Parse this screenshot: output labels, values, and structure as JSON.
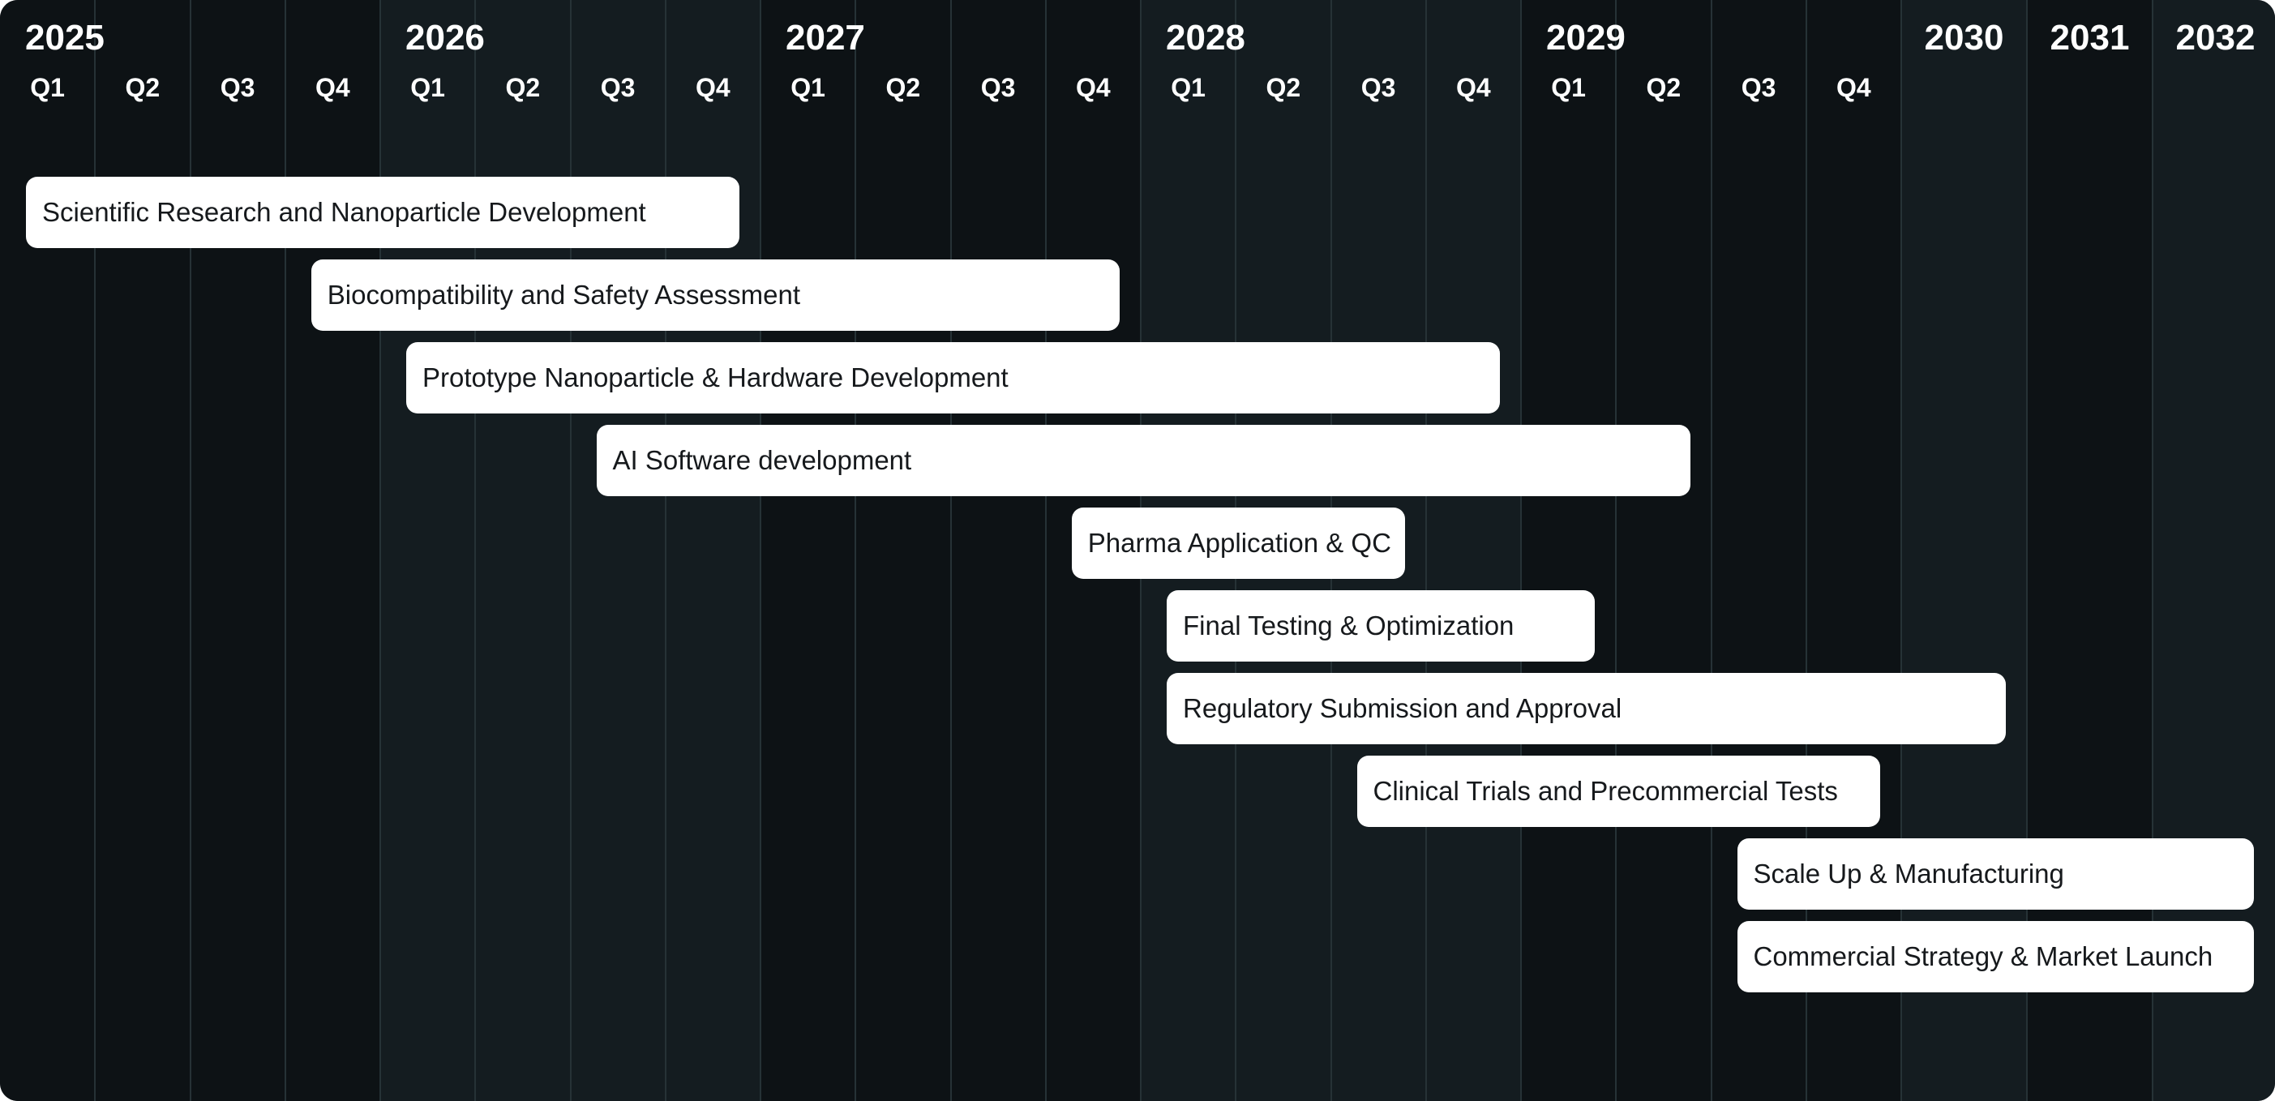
{
  "chart_data": {
    "type": "gantt",
    "title": "",
    "time_axis": {
      "years": [
        "2025",
        "2026",
        "2027",
        "2028",
        "2029",
        "2030",
        "2031",
        "2032"
      ],
      "quarterly_years": [
        "2025",
        "2026",
        "2027",
        "2028",
        "2029"
      ],
      "quarter_labels": [
        "Q1",
        "Q2",
        "Q3",
        "Q4"
      ],
      "start": "2025-Q1",
      "end": "2032-end",
      "note_resolution": "quarters shown for 2025-2029, whole years for 2030-2032"
    },
    "tasks": [
      {
        "name": "Scientific Research and Nanoparticle Development",
        "start": "2025-Q1",
        "end": "2026-Q4"
      },
      {
        "name": "Biocompatibility and Safety Assessment",
        "start": "2025-Q4",
        "end": "2027-Q4"
      },
      {
        "name": "Prototype Nanoparticle & Hardware Development",
        "start": "2026-Q1",
        "end": "2028-Q4"
      },
      {
        "name": "AI Software development",
        "start": "2026-Q3",
        "end": "2029-Q2"
      },
      {
        "name": "Pharma Application & QC",
        "start": "2027-Q4",
        "end": "2028-Q3"
      },
      {
        "name": "Final Testing & Optimization",
        "start": "2028-Q1",
        "end": "2029-Q1"
      },
      {
        "name": "Regulatory Submission and Approval",
        "start": "2028-Q1",
        "end": "2030"
      },
      {
        "name": "Clinical Trials and Precommercial Tests",
        "start": "2028-Q3",
        "end": "2029-Q4"
      },
      {
        "name": "Scale Up & Manufacturing",
        "start": "2029-Q3",
        "end": "2032"
      },
      {
        "name": "Commercial Strategy & Market Launch",
        "start": "2029-Q3",
        "end": "2032"
      }
    ]
  },
  "colors": {
    "background": "#0d1215",
    "alternate_band": "#141c20",
    "gridline": "#263236",
    "bar": "#ffffff",
    "bar_text": "#16191c",
    "header_text": "#ffffff"
  }
}
